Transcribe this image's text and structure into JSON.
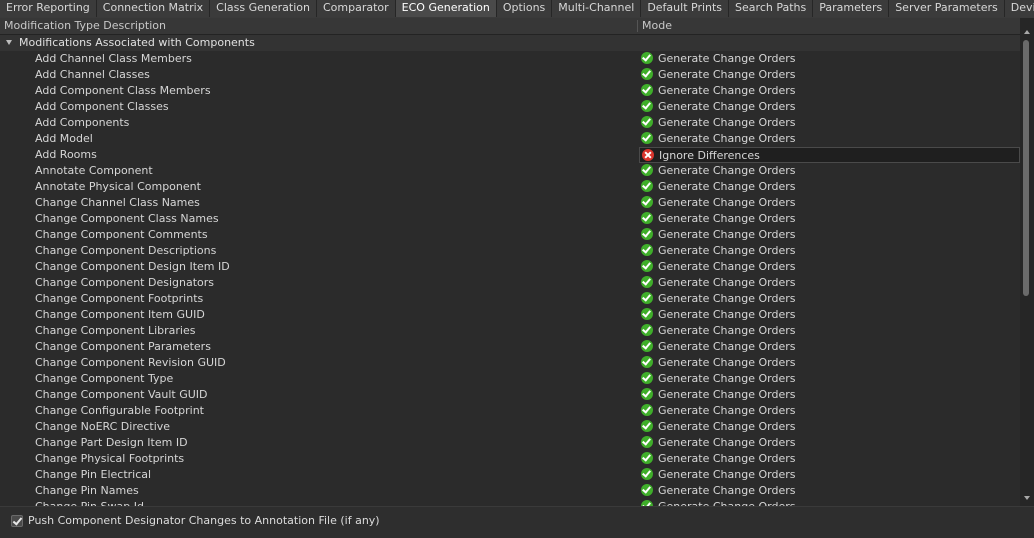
{
  "tabs": [
    {
      "label": "Error Reporting",
      "active": false
    },
    {
      "label": "Connection Matrix",
      "active": false
    },
    {
      "label": "Class Generation",
      "active": false
    },
    {
      "label": "Comparator",
      "active": false
    },
    {
      "label": "ECO Generation",
      "active": true
    },
    {
      "label": "Options",
      "active": false
    },
    {
      "label": "Multi-Channel",
      "active": false
    },
    {
      "label": "Default Prints",
      "active": false
    },
    {
      "label": "Search Paths",
      "active": false
    },
    {
      "label": "Parameters",
      "active": false
    },
    {
      "label": "Server Parameters",
      "active": false
    },
    {
      "label": "Device Sheets",
      "active": false
    }
  ],
  "columns": {
    "description": "Modification Type Description",
    "mode": "Mode"
  },
  "group": {
    "label": "Modifications Associated with Components"
  },
  "rows": [
    {
      "label": "Add Channel Class Members",
      "mode": "Generate Change Orders",
      "icon": "check-icon",
      "selected": false
    },
    {
      "label": "Add Channel Classes",
      "mode": "Generate Change Orders",
      "icon": "check-icon",
      "selected": false
    },
    {
      "label": "Add Component Class Members",
      "mode": "Generate Change Orders",
      "icon": "check-icon",
      "selected": false
    },
    {
      "label": "Add Component Classes",
      "mode": "Generate Change Orders",
      "icon": "check-icon",
      "selected": false
    },
    {
      "label": "Add Components",
      "mode": "Generate Change Orders",
      "icon": "check-icon",
      "selected": false
    },
    {
      "label": "Add Model",
      "mode": "Generate Change Orders",
      "icon": "check-icon",
      "selected": false
    },
    {
      "label": "Add Rooms",
      "mode": "Ignore Differences",
      "icon": "ignore-icon",
      "selected": true
    },
    {
      "label": "Annotate Component",
      "mode": "Generate Change Orders",
      "icon": "check-icon",
      "selected": false
    },
    {
      "label": "Annotate Physical Component",
      "mode": "Generate Change Orders",
      "icon": "check-icon",
      "selected": false
    },
    {
      "label": "Change Channel Class Names",
      "mode": "Generate Change Orders",
      "icon": "check-icon",
      "selected": false
    },
    {
      "label": "Change Component Class Names",
      "mode": "Generate Change Orders",
      "icon": "check-icon",
      "selected": false
    },
    {
      "label": "Change Component Comments",
      "mode": "Generate Change Orders",
      "icon": "check-icon",
      "selected": false
    },
    {
      "label": "Change Component Descriptions",
      "mode": "Generate Change Orders",
      "icon": "check-icon",
      "selected": false
    },
    {
      "label": "Change Component Design Item ID",
      "mode": "Generate Change Orders",
      "icon": "check-icon",
      "selected": false
    },
    {
      "label": "Change Component Designators",
      "mode": "Generate Change Orders",
      "icon": "check-icon",
      "selected": false
    },
    {
      "label": "Change Component Footprints",
      "mode": "Generate Change Orders",
      "icon": "check-icon",
      "selected": false
    },
    {
      "label": "Change Component Item GUID",
      "mode": "Generate Change Orders",
      "icon": "check-icon",
      "selected": false
    },
    {
      "label": "Change Component Libraries",
      "mode": "Generate Change Orders",
      "icon": "check-icon",
      "selected": false
    },
    {
      "label": "Change Component Parameters",
      "mode": "Generate Change Orders",
      "icon": "check-icon",
      "selected": false
    },
    {
      "label": "Change Component Revision GUID",
      "mode": "Generate Change Orders",
      "icon": "check-icon",
      "selected": false
    },
    {
      "label": "Change Component Type",
      "mode": "Generate Change Orders",
      "icon": "check-icon",
      "selected": false
    },
    {
      "label": "Change Component Vault GUID",
      "mode": "Generate Change Orders",
      "icon": "check-icon",
      "selected": false
    },
    {
      "label": "Change Configurable Footprint",
      "mode": "Generate Change Orders",
      "icon": "check-icon",
      "selected": false
    },
    {
      "label": "Change NoERC Directive",
      "mode": "Generate Change Orders",
      "icon": "check-icon",
      "selected": false
    },
    {
      "label": "Change Part Design Item ID",
      "mode": "Generate Change Orders",
      "icon": "check-icon",
      "selected": false
    },
    {
      "label": "Change Physical Footprints",
      "mode": "Generate Change Orders",
      "icon": "check-icon",
      "selected": false
    },
    {
      "label": "Change Pin Electrical",
      "mode": "Generate Change Orders",
      "icon": "check-icon",
      "selected": false
    },
    {
      "label": "Change Pin Names",
      "mode": "Generate Change Orders",
      "icon": "check-icon",
      "selected": false
    },
    {
      "label": "Change Pin Swap Id",
      "mode": "Generate Change Orders",
      "icon": "check-icon",
      "selected": false
    }
  ],
  "footer": {
    "checkbox_label": "Push Component Designator Changes to Annotation File (if any)",
    "checked": true
  },
  "colors": {
    "accent_ok": "#3fae2a",
    "accent_ignore": "#d8342c",
    "background": "#2b2b2b"
  }
}
